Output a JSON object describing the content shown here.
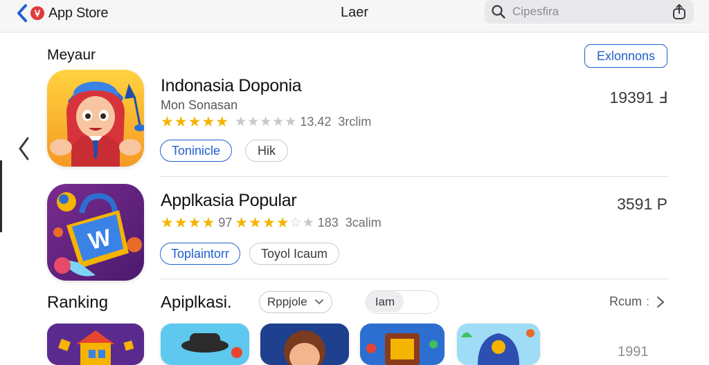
{
  "topbar": {
    "back_label": "App Store",
    "title": "Laer",
    "search_placeholder": "Cipesfira"
  },
  "featured": {
    "section_title": "Meyaur",
    "explore_label": "Exlonnons",
    "apps": [
      {
        "name": "Indonasia Doponia",
        "developer": "Mon Sonasan",
        "stars_filled": "★★★★★",
        "stars_empty": "★★★★★",
        "rating_count": "13.42",
        "size": "3rclim",
        "tag_primary": "Toninicle",
        "tag_secondary": "Hik",
        "price": "19391 Ⅎ"
      },
      {
        "name": "Applkasia Popular",
        "stars_filled_a": "★★★★",
        "rating_mid": "97",
        "stars_filled_b": "★★★★",
        "stars_empty": "☆★",
        "rating_count": "183",
        "size": "3calim",
        "tag_primary": "Toplaintorr",
        "tag_secondary": "Toyol Icaum",
        "price": "3591 P"
      }
    ]
  },
  "ranking": {
    "title": "Ranking",
    "subtitle": "Apiplkasi.",
    "dropdown_value": "Rppjole",
    "toggle_label": "Iam",
    "link_label": "Rcum",
    "bottom_value": "1991"
  },
  "colors": {
    "accent": "#1f5fcf",
    "star": "#f4b400",
    "back_arrow": "#1e63d6",
    "logo": "#e03b3b"
  },
  "icons": [
    "chevron-left-icon",
    "app-store-logo-icon",
    "search-icon",
    "share-icon",
    "chevron-down-icon",
    "arrow-right-icon"
  ]
}
